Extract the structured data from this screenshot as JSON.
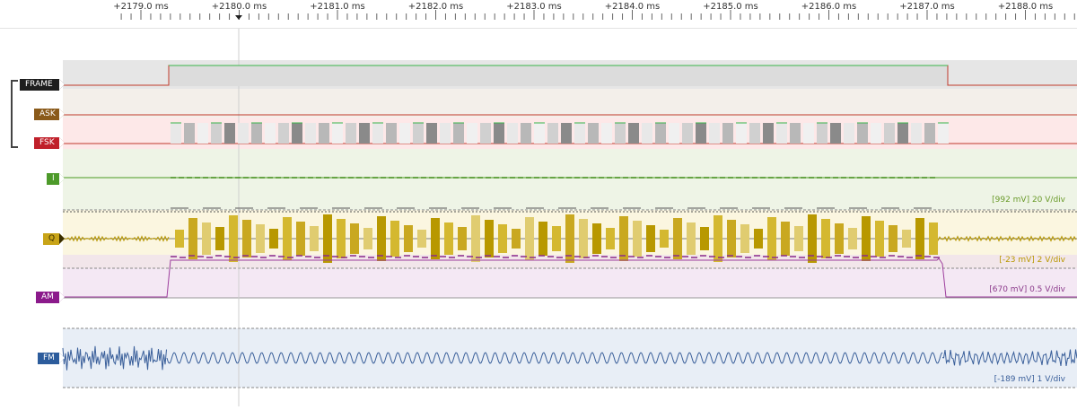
{
  "ruler": {
    "ticks": [
      "+2179.0 ms",
      "+2180.0 ms",
      "+2181.0 ms",
      "+2182.0 ms",
      "+2183.0 ms",
      "+2184.0 ms",
      "+2185.0 ms",
      "+2186.0 ms",
      "+2187.0 ms",
      "+2188.0 ms"
    ]
  },
  "channels": [
    {
      "id": "frame",
      "label": "FRAME",
      "color": "#1e1e1e",
      "trace": "#c0392b",
      "scale": ""
    },
    {
      "id": "ask",
      "label": "ASK",
      "color": "#8a5a1a",
      "trace": "#c0392b",
      "scale": ""
    },
    {
      "id": "fsk",
      "label": "FSK",
      "color": "#c0202a",
      "trace": "#c0392b",
      "scale": ""
    },
    {
      "id": "i",
      "label": "I",
      "color": "#4d9a2a",
      "trace": "#3a8a1a",
      "scale": "[992 mV] 20 V/div"
    },
    {
      "id": "q",
      "label": "Q",
      "color": "#c8a418",
      "trace": "#b89800",
      "scale": "[-23 mV] 2 V/div"
    },
    {
      "id": "am",
      "label": "AM",
      "color": "#8b1a8b",
      "trace": "#9c3c9c",
      "scale": "[670 mV] 0.5 V/div"
    },
    {
      "id": "fm",
      "label": "FM",
      "color": "#2c5c9c",
      "trace": "#3a5f9a",
      "scale": "[-189 mV] 1 V/div"
    }
  ],
  "colors": {
    "frame_high": "#39b54a",
    "cursor": "#cfcfcf",
    "separator": "#9a9a9a"
  }
}
